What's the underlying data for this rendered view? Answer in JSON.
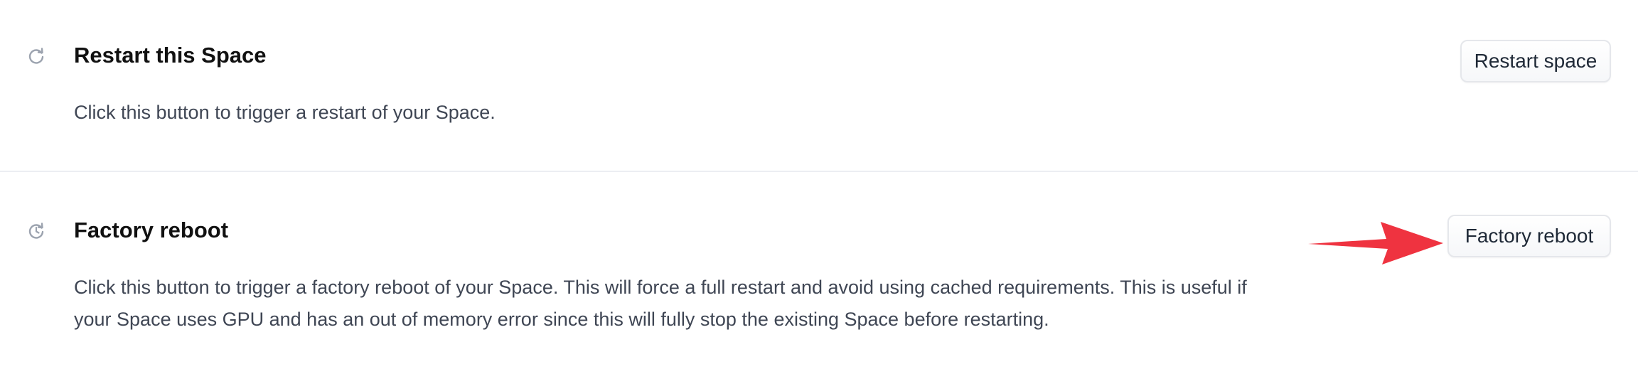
{
  "restart": {
    "icon": "restart-icon",
    "title": "Restart this Space",
    "description": "Click this button to trigger a restart of your Space.",
    "button_label": "Restart space"
  },
  "factory": {
    "icon": "factory-reboot-icon",
    "title": "Factory reboot",
    "description": "Click this button to trigger a factory reboot of your Space. This will force a full restart and avoid using cached requirements. This is useful if your Space uses GPU and has an out of memory error since this will fully stop the existing Space before restarting.",
    "button_label": "Factory reboot"
  },
  "annotation": {
    "icon": "red-arrow-icon",
    "color": "#ef3340"
  }
}
